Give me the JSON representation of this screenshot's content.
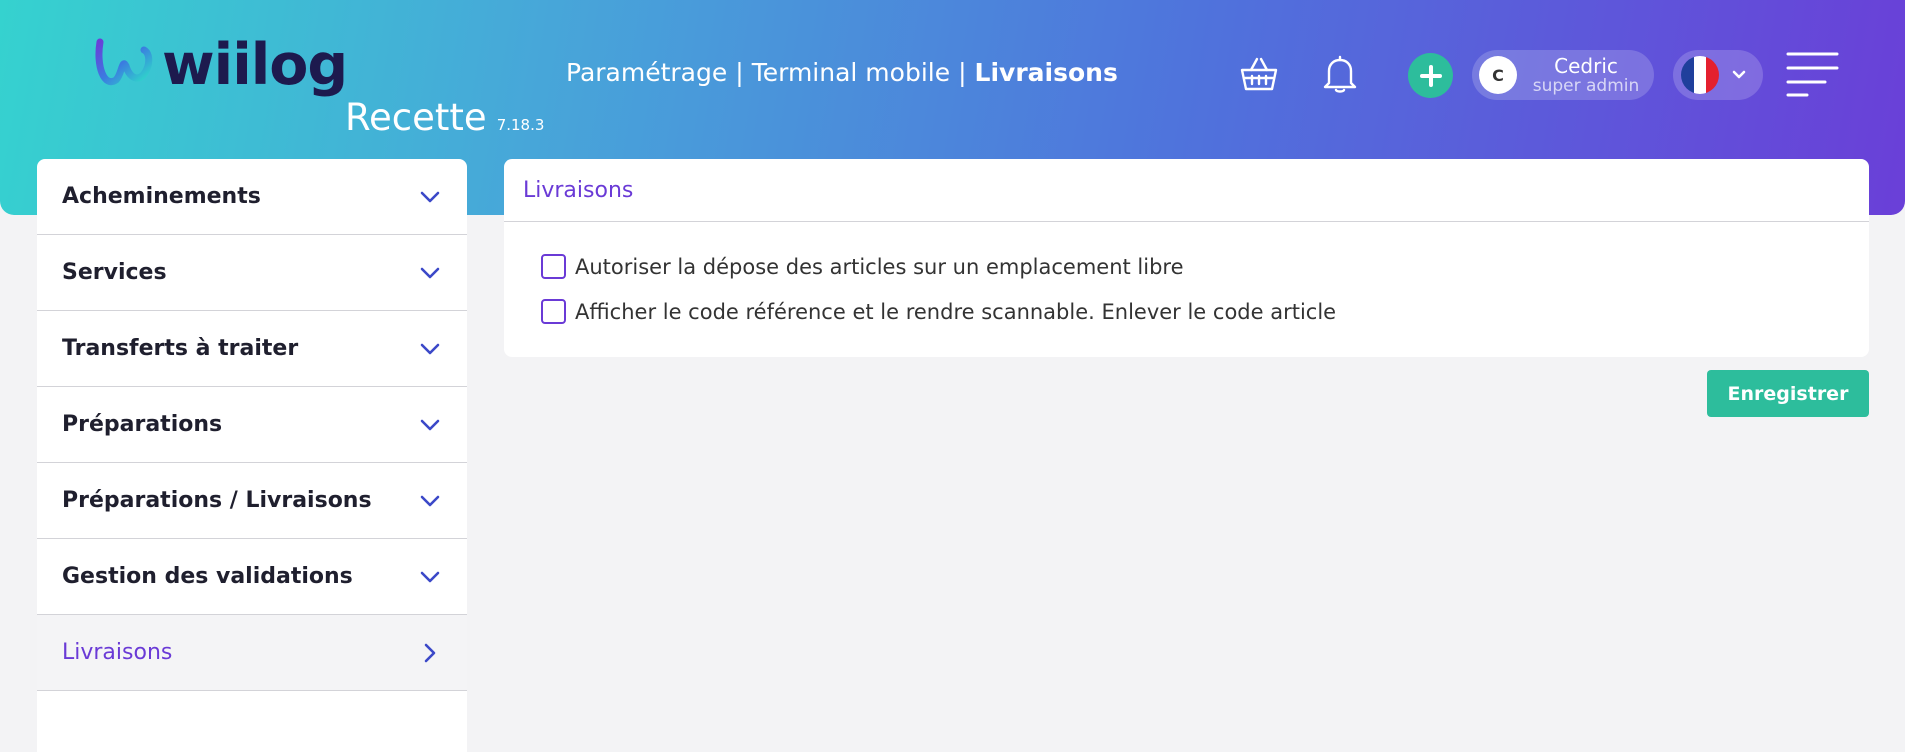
{
  "brand": {
    "logo_text": "wiilog",
    "environment": "Recette",
    "version": "7.18.3"
  },
  "breadcrumb": {
    "items": [
      "Paramétrage",
      "Terminal mobile"
    ],
    "current": "Livraisons",
    "separator": "|"
  },
  "header": {
    "icons": [
      "basket-icon",
      "bell-icon",
      "plus-icon",
      "menu-icon"
    ],
    "user": {
      "avatar_initial": "C",
      "name": "Cedric",
      "role": "super admin"
    },
    "language": {
      "flag": "fr-flag-icon"
    }
  },
  "sidebar": {
    "items": [
      {
        "label": "Acheminements",
        "icon": "chevron-down-icon"
      },
      {
        "label": "Services",
        "icon": "chevron-down-icon"
      },
      {
        "label": "Transferts à traiter",
        "icon": "chevron-down-icon"
      },
      {
        "label": "Préparations",
        "icon": "chevron-down-icon"
      },
      {
        "label": "Préparations / Livraisons",
        "icon": "chevron-down-icon"
      },
      {
        "label": "Gestion des validations",
        "icon": "chevron-down-icon"
      },
      {
        "label": "Livraisons",
        "icon": "chevron-right-icon",
        "active": true
      }
    ]
  },
  "panel": {
    "title": "Livraisons",
    "options": [
      {
        "label": "Autoriser la dépose des articles sur un emplacement libre",
        "checked": false
      },
      {
        "label": "Afficher le code référence et le rendre scannable. Enlever le code article",
        "checked": false
      }
    ]
  },
  "actions": {
    "save_label": "Enregistrer"
  },
  "colors": {
    "accent": "#6a3ad6",
    "success": "#2dbd9c",
    "gradient_start": "#35d2cf",
    "gradient_end": "#6a3fd8"
  }
}
